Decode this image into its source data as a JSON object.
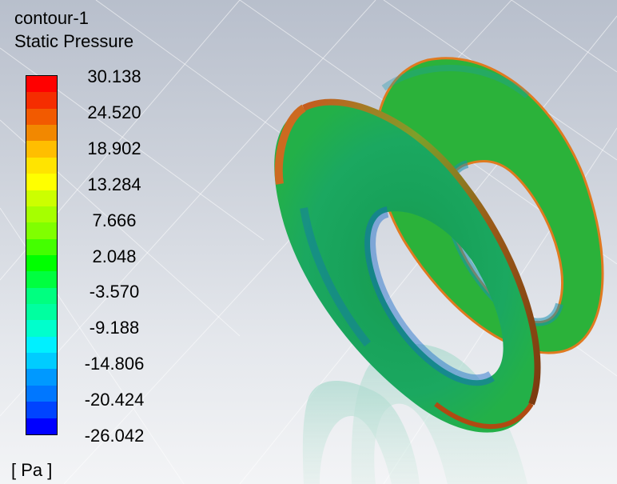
{
  "contour": {
    "name": "contour-1",
    "variable": "Static Pressure",
    "units": "[ Pa ]"
  },
  "legend": {
    "labels": [
      "30.138",
      "24.520",
      "18.902",
      "13.284",
      "7.666",
      "2.048",
      "-3.570",
      "-9.188",
      "-14.806",
      "-20.424",
      "-26.042"
    ],
    "colors": [
      "#ff0000",
      "#f52d00",
      "#f25a00",
      "#f28800",
      "#ffbe00",
      "#ffe400",
      "#ffff00",
      "#ccff00",
      "#a6ff00",
      "#80ff00",
      "#44ff00",
      "#00ff00",
      "#00ff40",
      "#00ff80",
      "#00ffa0",
      "#00ffcc",
      "#00f0ff",
      "#00ccff",
      "#0099ff",
      "#0077ff",
      "#0044ff",
      "#0000ff"
    ]
  }
}
